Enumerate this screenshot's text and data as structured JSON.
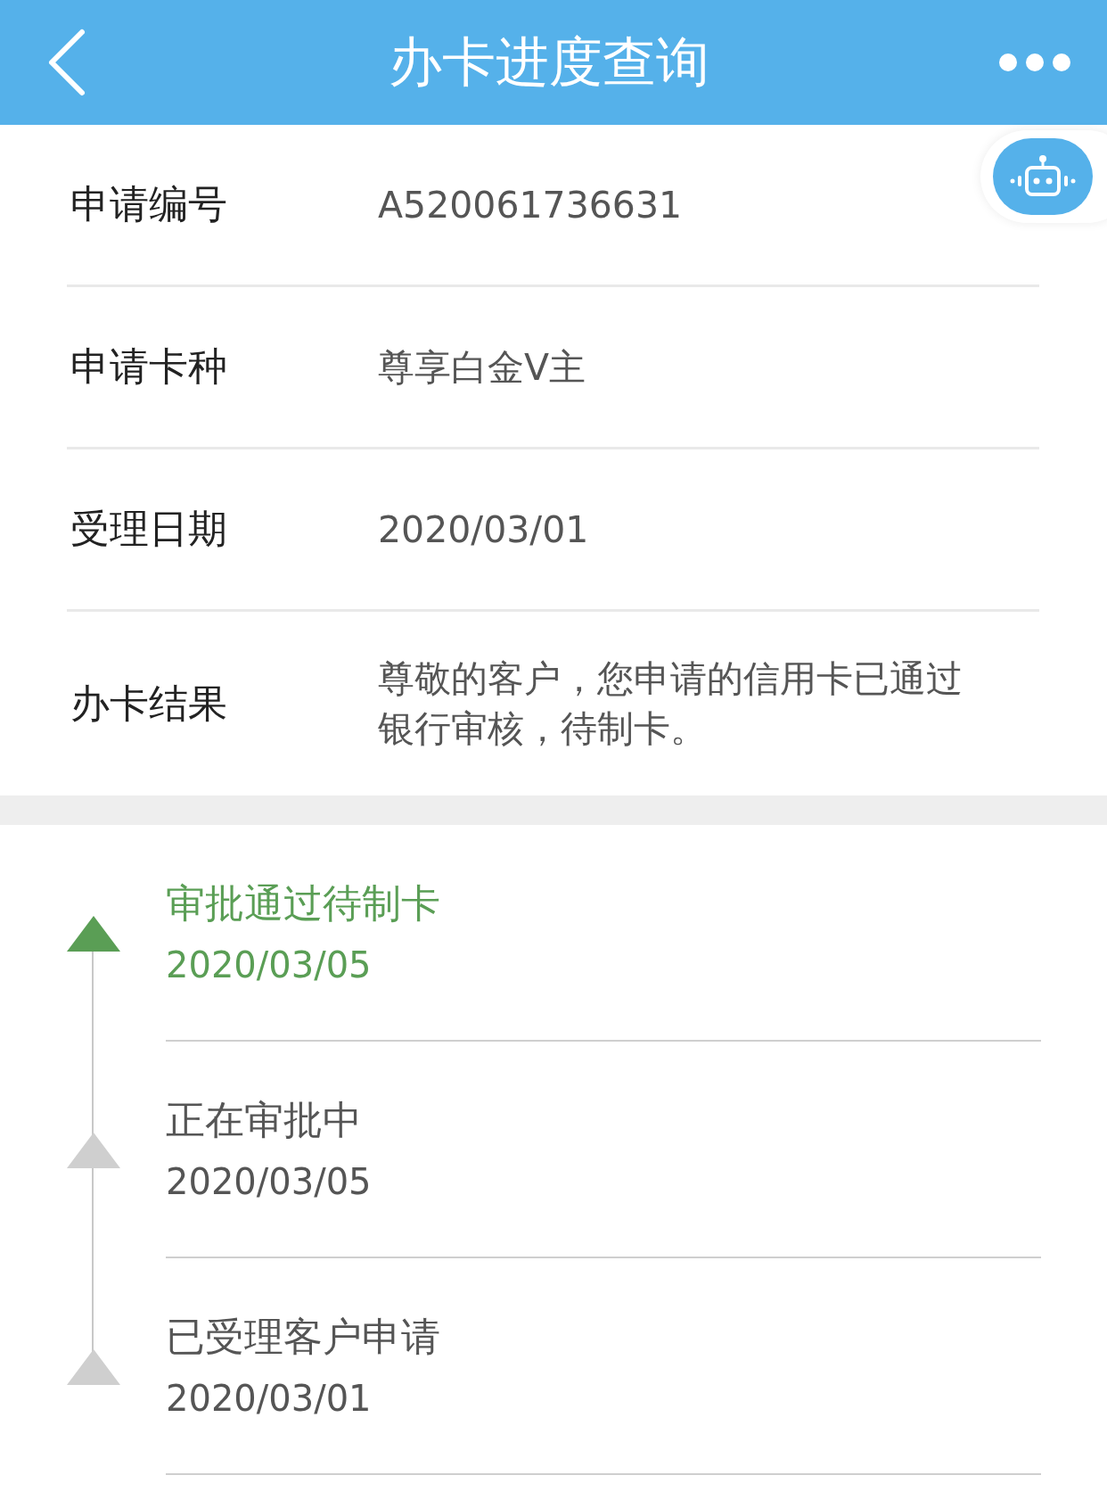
{
  "header": {
    "title": "办卡进度查询"
  },
  "details": [
    {
      "label": "申请编号",
      "value": "A520061736631"
    },
    {
      "label": "申请卡种",
      "value": "尊享白金V主"
    },
    {
      "label": "受理日期",
      "value": "2020/03/01"
    },
    {
      "label": "办卡结果",
      "value": "尊敬的客户，您申请的信用卡已通过银行审核，待制卡。"
    }
  ],
  "timeline": [
    {
      "status": "审批通过待制卡",
      "date": "2020/03/05",
      "current": true
    },
    {
      "status": "正在审批中",
      "date": "2020/03/05",
      "current": false
    },
    {
      "status": "已受理客户申请",
      "date": "2020/03/01",
      "current": false
    }
  ]
}
